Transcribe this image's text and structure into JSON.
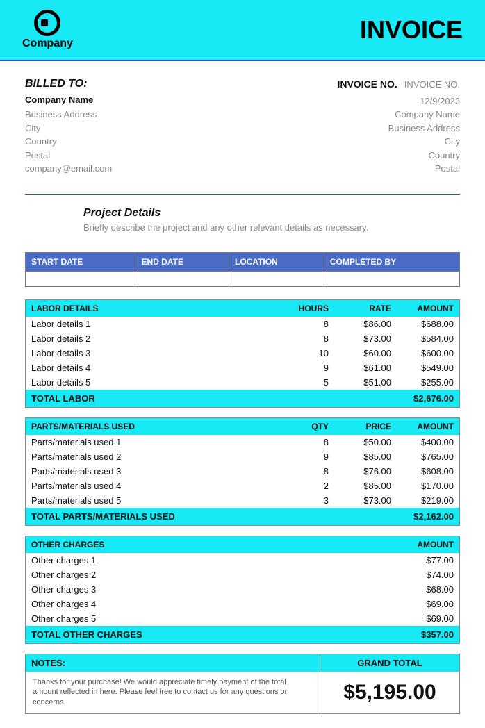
{
  "header": {
    "company_logo_text": "Company",
    "invoice_title": "INVOICE"
  },
  "billed_to": {
    "heading": "BILLED TO:",
    "company": "Company Name",
    "address": "Business Address",
    "city": "City",
    "country": "Country",
    "postal": "Postal",
    "email": "company@email.com"
  },
  "invoice_meta": {
    "invoice_no_label": "INVOICE NO.",
    "invoice_no_value": "INVOICE NO.",
    "date": "12/9/2023",
    "company": "Company Name",
    "address": "Business Address",
    "city": "City",
    "country": "Country",
    "postal": "Postal"
  },
  "project": {
    "heading": "Project Details",
    "description": "Briefly describe the project and any other relevant details as necessary."
  },
  "schedule": {
    "headers": {
      "start": "START DATE",
      "end": "END DATE",
      "location": "LOCATION",
      "completed": "COMPLETED BY"
    },
    "values": {
      "start": "",
      "end": "",
      "location": "",
      "completed": ""
    }
  },
  "labor": {
    "title": "LABOR DETAILS",
    "cols": {
      "hours": "HOURS",
      "rate": "RATE",
      "amount": "AMOUNT"
    },
    "rows": [
      {
        "name": "Labor details 1",
        "hours": "8",
        "rate": "$86.00",
        "amount": "$688.00"
      },
      {
        "name": "Labor details 2",
        "hours": "8",
        "rate": "$73.00",
        "amount": "$584.00"
      },
      {
        "name": "Labor details 3",
        "hours": "10",
        "rate": "$60.00",
        "amount": "$600.00"
      },
      {
        "name": "Labor details 4",
        "hours": "9",
        "rate": "$61.00",
        "amount": "$549.00"
      },
      {
        "name": "Labor details 5",
        "hours": "5",
        "rate": "$51.00",
        "amount": "$255.00"
      }
    ],
    "total_label": "TOTAL LABOR",
    "total_amount": "$2,676.00"
  },
  "parts": {
    "title": "PARTS/MATERIALS USED",
    "cols": {
      "qty": "QTY",
      "price": "PRICE",
      "amount": "AMOUNT"
    },
    "rows": [
      {
        "name": "Parts/materials used 1",
        "qty": "8",
        "price": "$50.00",
        "amount": "$400.00"
      },
      {
        "name": "Parts/materials used 2",
        "qty": "9",
        "price": "$85.00",
        "amount": "$765.00"
      },
      {
        "name": "Parts/materials used 3",
        "qty": "8",
        "price": "$76.00",
        "amount": "$608.00"
      },
      {
        "name": "Parts/materials used 4",
        "qty": "2",
        "price": "$85.00",
        "amount": "$170.00"
      },
      {
        "name": "Parts/materials used 5",
        "qty": "3",
        "price": "$73.00",
        "amount": "$219.00"
      }
    ],
    "total_label": "TOTAL PARTS/MATERIALS USED",
    "total_amount": "$2,162.00"
  },
  "other": {
    "title": "OTHER CHARGES",
    "cols": {
      "amount": "AMOUNT"
    },
    "rows": [
      {
        "name": "Other charges 1",
        "amount": "$77.00"
      },
      {
        "name": "Other charges 2",
        "amount": "$74.00"
      },
      {
        "name": "Other charges 3",
        "amount": "$68.00"
      },
      {
        "name": "Other charges 4",
        "amount": "$69.00"
      },
      {
        "name": "Other charges 5",
        "amount": "$69.00"
      }
    ],
    "total_label": "TOTAL OTHER CHARGES",
    "total_amount": "$357.00"
  },
  "notes": {
    "heading": "NOTES:",
    "body": "Thanks for your purchase! We would appreciate timely payment of the total amount reflected in here. Please feel free to contact us for any questions or concerns."
  },
  "grand_total": {
    "heading": "GRAND TOTAL",
    "value": "$5,195.00"
  }
}
